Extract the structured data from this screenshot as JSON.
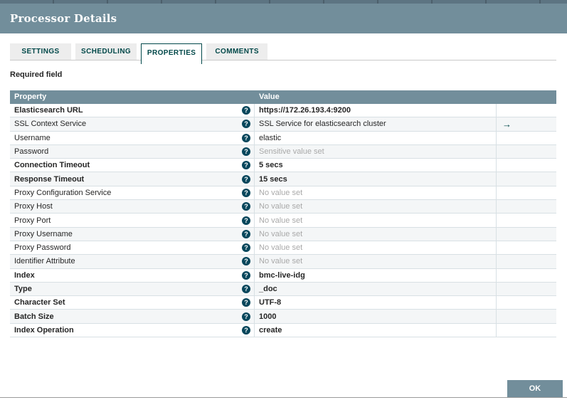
{
  "dialog": {
    "title": "Processor Details"
  },
  "tabs": [
    {
      "label": "SETTINGS",
      "active": false
    },
    {
      "label": "SCHEDULING",
      "active": false
    },
    {
      "label": "PROPERTIES",
      "active": true
    },
    {
      "label": "COMMENTS",
      "active": false
    }
  ],
  "properties_panel": {
    "required_label": "Required field"
  },
  "table": {
    "columns": [
      "Property",
      "Value"
    ],
    "rows": [
      {
        "property": "Elasticsearch URL",
        "required": true,
        "value": "https://172.26.193.4:9200",
        "unset": false,
        "goto": false
      },
      {
        "property": "SSL Context Service",
        "required": false,
        "value": "SSL Service for elasticsearch cluster",
        "unset": false,
        "goto": true
      },
      {
        "property": "Username",
        "required": false,
        "value": "elastic",
        "unset": false,
        "goto": false
      },
      {
        "property": "Password",
        "required": false,
        "value": "Sensitive value set",
        "unset": true,
        "goto": false
      },
      {
        "property": "Connection Timeout",
        "required": true,
        "value": "5 secs",
        "unset": false,
        "goto": false
      },
      {
        "property": "Response Timeout",
        "required": true,
        "value": "15 secs",
        "unset": false,
        "goto": false
      },
      {
        "property": "Proxy Configuration Service",
        "required": false,
        "value": "No value set",
        "unset": true,
        "goto": false
      },
      {
        "property": "Proxy Host",
        "required": false,
        "value": "No value set",
        "unset": true,
        "goto": false
      },
      {
        "property": "Proxy Port",
        "required": false,
        "value": "No value set",
        "unset": true,
        "goto": false
      },
      {
        "property": "Proxy Username",
        "required": false,
        "value": "No value set",
        "unset": true,
        "goto": false
      },
      {
        "property": "Proxy Password",
        "required": false,
        "value": "No value set",
        "unset": true,
        "goto": false
      },
      {
        "property": "Identifier Attribute",
        "required": false,
        "value": "No value set",
        "unset": true,
        "goto": false
      },
      {
        "property": "Index",
        "required": true,
        "value": "bmc-live-idg",
        "unset": false,
        "goto": false
      },
      {
        "property": "Type",
        "required": true,
        "value": "_doc",
        "unset": false,
        "goto": false
      },
      {
        "property": "Character Set",
        "required": true,
        "value": "UTF-8",
        "unset": false,
        "goto": false
      },
      {
        "property": "Batch Size",
        "required": true,
        "value": "1000",
        "unset": false,
        "goto": false
      },
      {
        "property": "Index Operation",
        "required": true,
        "value": "create",
        "unset": false,
        "goto": false
      }
    ]
  },
  "icons": {
    "help_glyph": "?",
    "goto_glyph": "→"
  },
  "buttons": {
    "ok": "OK"
  },
  "colors": {
    "header_bg": "#728E9B",
    "accent_teal": "#004849",
    "help_icon_bg": "#07475c",
    "row_alt_bg": "#f4f6f7",
    "unset_text": "#a9a9a9",
    "row_border": "#d8e0e4"
  }
}
